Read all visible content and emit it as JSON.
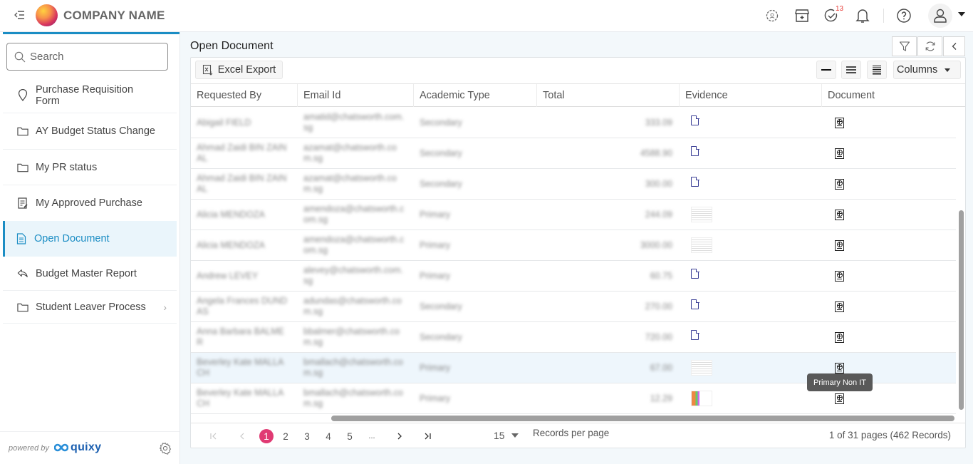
{
  "app": {
    "company_name": "COMPANY NAME",
    "notification_badge": "13"
  },
  "topbar": {
    "icons": [
      "menu-collapse-icon",
      "settings-cog-icon",
      "store-icon",
      "tasks-check-icon",
      "bell-icon",
      "help-icon",
      "user-icon"
    ]
  },
  "sidebar": {
    "search_placeholder": "Search",
    "items": [
      {
        "label": "Purchase Requisition Form",
        "icon": "map-pin-icon"
      },
      {
        "label": "AY Budget Status Change",
        "icon": "folder-icon"
      },
      {
        "label": "My PR status",
        "icon": "folder-icon"
      },
      {
        "label": "My Approved Purchase",
        "icon": "edit-document-icon"
      },
      {
        "label": "Open Document",
        "icon": "document-icon",
        "active": true
      },
      {
        "label": "Budget Master Report",
        "icon": "reply-arrow-icon"
      },
      {
        "label": "Student Leaver Process",
        "icon": "folder-icon",
        "has_children": true
      }
    ],
    "footer": {
      "powered_by": "powered by",
      "brand": "quixy"
    }
  },
  "main": {
    "page_title": "Open Document",
    "toolbar": {
      "excel_export": "Excel Export",
      "columns": "Columns"
    },
    "grid": {
      "columns": [
        "Requested By",
        "Email Id",
        "Academic Type",
        "Total",
        "Evidence",
        "Document"
      ],
      "rows": [
        {
          "requested_by": "Abigail FIELD",
          "email": "amatid@chatsworth.com.sg",
          "academic_type": "Secondary",
          "total": "333.09",
          "evidence": "file",
          "document": "web-document"
        },
        {
          "requested_by": "Ahmad Zaidi BIN ZAINAL",
          "email": "azamat@chatsworth.com.sg",
          "academic_type": "Secondary",
          "total": "4588.90",
          "evidence": "file",
          "document": "web-document"
        },
        {
          "requested_by": "Ahmad Zaidi BIN ZAINAL",
          "email": "azamat@chatsworth.com.sg",
          "academic_type": "Secondary",
          "total": "300.00",
          "evidence": "file",
          "document": "web-document"
        },
        {
          "requested_by": "Alicia MENDOZA",
          "email": "amendoza@chatsworth.com.sg",
          "academic_type": "Primary",
          "total": "244.09",
          "evidence": "thumbnail",
          "document": "web-document"
        },
        {
          "requested_by": "Alicia MENDOZA",
          "email": "amendoza@chatsworth.com.sg",
          "academic_type": "Primary",
          "total": "3000.00",
          "evidence": "thumbnail",
          "document": "web-document"
        },
        {
          "requested_by": "Andrew LEVEY",
          "email": "alevey@chatsworth.com.sg",
          "academic_type": "Primary",
          "total": "60.75",
          "evidence": "file",
          "document": "web-document"
        },
        {
          "requested_by": "Angela Frances DUNDAS",
          "email": "adundas@chatsworth.com.sg",
          "academic_type": "Secondary",
          "total": "270.00",
          "evidence": "file",
          "document": "web-document"
        },
        {
          "requested_by": "Anna Barbara BALMER",
          "email": "bbalmer@chatsworth.com.sg",
          "academic_type": "Secondary",
          "total": "720.00",
          "evidence": "file",
          "document": "web-document"
        },
        {
          "requested_by": "Beverley Kate MALLACH",
          "email": "bmallach@chatsworth.com.sg",
          "academic_type": "Primary",
          "total": "67.00",
          "evidence": "thumbnail",
          "document": "web-document",
          "hover": true
        },
        {
          "requested_by": "Beverley Kate MALLACH",
          "email": "bmallach@chatsworth.com.sg",
          "academic_type": "Primary",
          "total": "12.29",
          "evidence": "thumbnail-color",
          "document": "web-document"
        }
      ],
      "tooltip": "Primary Non IT"
    },
    "pagination": {
      "pages": [
        "1",
        "2",
        "3",
        "4",
        "5",
        "..."
      ],
      "current_page": "1",
      "records_per_page": "15",
      "records_per_page_label": "Records per page",
      "summary": "1 of 31 pages (462 Records)"
    }
  }
}
